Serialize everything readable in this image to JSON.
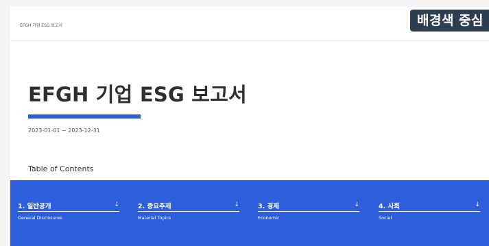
{
  "header": {
    "breadcrumb": "EFGH 기업 ESG 보고서",
    "badge": "배경색 중심"
  },
  "main": {
    "title": "EFGH 기업 ESG 보고서",
    "period": "2023-01-01 ~ 2023-12-31",
    "toc_heading": "Table of Contents"
  },
  "toc": {
    "items": [
      {
        "label": "1. 일반공개",
        "sub": "General Disclosures",
        "arrow": "↓"
      },
      {
        "label": "2. 중요주제",
        "sub": "Material Topics",
        "arrow": "↓"
      },
      {
        "label": "3. 경제",
        "sub": "Economic",
        "arrow": "↓"
      },
      {
        "label": "4. 사회",
        "sub": "Social",
        "arrow": "↓"
      }
    ]
  },
  "colors": {
    "accent": "#2d5fdc",
    "badge_bg": "#2c3e50",
    "text": "#2f2f2f"
  }
}
